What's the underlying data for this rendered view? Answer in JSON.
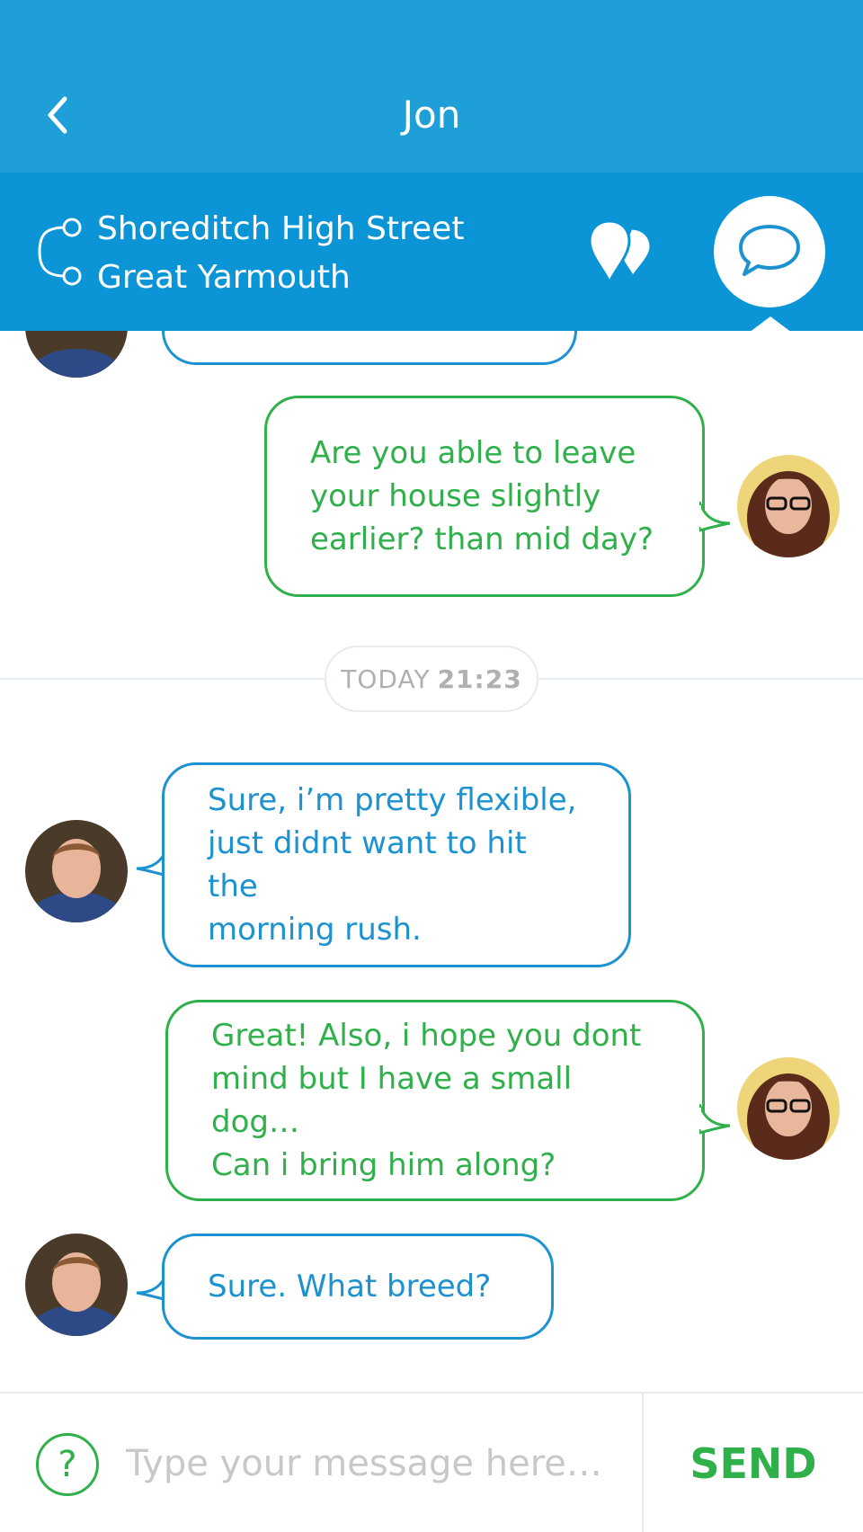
{
  "header": {
    "title": "Jon"
  },
  "route": {
    "from": "Shoreditch High Street",
    "to": "Great Yarmouth"
  },
  "messages": [
    {
      "direction": "out",
      "text": "Are you able to leave\nyour house slightly\nearlier? than mid day?"
    },
    {
      "direction": "in",
      "text": "Sure, i’m pretty flexible,\njust didnt want to hit the\nmorning rush."
    },
    {
      "direction": "out",
      "text": "Great! Also, i hope you dont\nmind but I have a small dog…\nCan i bring him along?"
    },
    {
      "direction": "in",
      "text": "Sure. What breed?"
    }
  ],
  "timestamp": {
    "day": "TODAY",
    "time": "21:23"
  },
  "composer": {
    "placeholder": "Type your message here…",
    "send_label": "SEND",
    "help_label": "?"
  },
  "colors": {
    "header": "#1f9fd8",
    "route_bar": "#0b94d6",
    "incoming": "#1c92d0",
    "outgoing": "#2fb04a"
  }
}
